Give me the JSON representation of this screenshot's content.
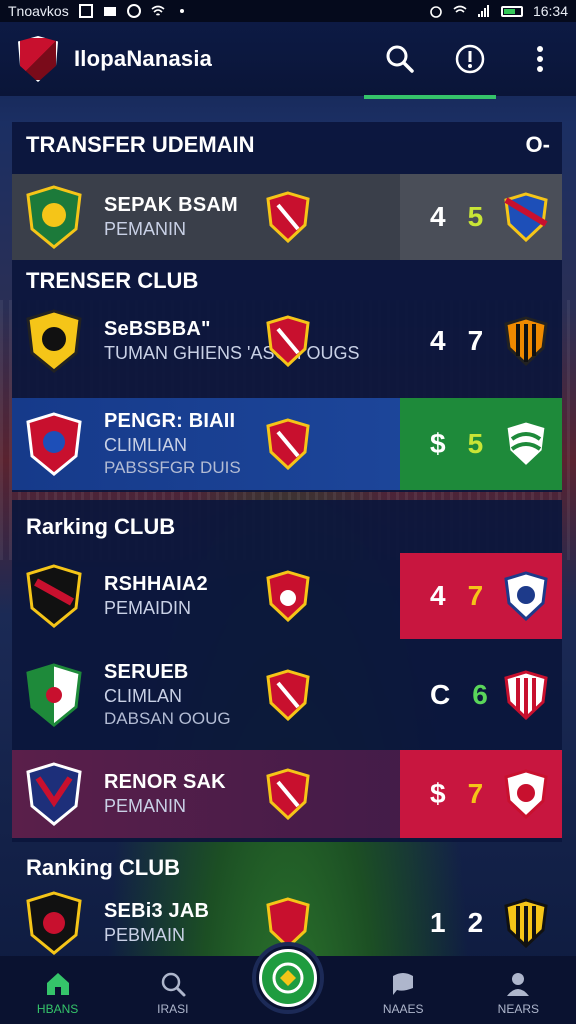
{
  "status_bar": {
    "carrier": "Tnoavkos",
    "time": "16:34"
  },
  "app_bar": {
    "title": "IlopaNanasia",
    "search_icon": "search-icon",
    "info_icon": "info-icon",
    "more_icon": "more-vert-icon",
    "active_tab_color": "#35c46a"
  },
  "sections": [
    {
      "title": "TRANSFER UDEMAIN",
      "action_glyph": "O-"
    },
    {
      "title": "TRENSER CLUB"
    },
    {
      "title": "Rarking CLUB"
    },
    {
      "title": "Ranking CLUB"
    }
  ],
  "rows": [
    {
      "name": "SEPAK BSAM",
      "sub": "PEMANIN",
      "sub2": "",
      "score_a": "4",
      "score_b": "5",
      "score_b_color": "#c9e536",
      "box_color": "#4a4e58",
      "row_bg": "#3a3f4a",
      "crest": "green-club-crest"
    },
    {
      "name": "SeBSBBA\"",
      "sub": "TUMAN GHIENS 'ASOH OUGS",
      "sub2": "",
      "score_a": "4",
      "score_b": "7",
      "score_b_color": "#ffffff",
      "box_color": "transparent",
      "row_bg": "#0d1a46",
      "crest": "yellow-club-crest"
    },
    {
      "name": "PENGR: BIAII",
      "sub": "CLIMLIAN",
      "sub2": "PABSSFGR DUIS",
      "score_a": "$",
      "score_b": "5",
      "score_b_color": "#c9e536",
      "box_color": "#1e8a3a",
      "row_bg": "#1b3a8a",
      "crest": "blue-red-club-crest"
    },
    {
      "name": "RSHHAIA2",
      "sub": "PEMAIDIN",
      "sub2": "",
      "score_a": "4",
      "score_b": "7",
      "score_b_color": "#f5c518",
      "box_color": "#c8163f",
      "row_bg": "#0d1a46",
      "crest": "red-black-club-crest"
    },
    {
      "name": "SERUEB",
      "sub": "CLIMLAN",
      "sub2": "DABSAN OOUG",
      "score_a": "C",
      "score_b": "6",
      "score_b_color": "#5ad65a",
      "box_color": "transparent",
      "row_bg": "#0d1a46",
      "crest": "green-white-club-crest"
    },
    {
      "name": "RENOR SAK",
      "sub": "PEMANIN",
      "sub2": "",
      "score_a": "$",
      "score_b": "7",
      "score_b_color": "#f5c518",
      "box_color": "#c8163f",
      "row_bg": "#5a1f4a",
      "crest": "navy-red-club-crest"
    },
    {
      "name": "SEBi3 JAB",
      "sub": "PEBMAIN",
      "sub2": "",
      "score_a": "1",
      "score_b": "2",
      "score_b_color": "#ffffff",
      "box_color": "transparent",
      "row_bg": "#0d1a46",
      "crest": "dark-club-crest"
    }
  ],
  "bottom_nav": {
    "items": [
      {
        "label": "HBANS",
        "icon": "home-icon",
        "active": true
      },
      {
        "label": "IRASI",
        "icon": "search-icon",
        "active": false
      },
      {
        "label": "NAAES",
        "icon": "chat-icon",
        "active": false
      },
      {
        "label": "NEARS",
        "icon": "profile-icon",
        "active": false
      }
    ],
    "fab_icon": "club-emblem-icon"
  }
}
